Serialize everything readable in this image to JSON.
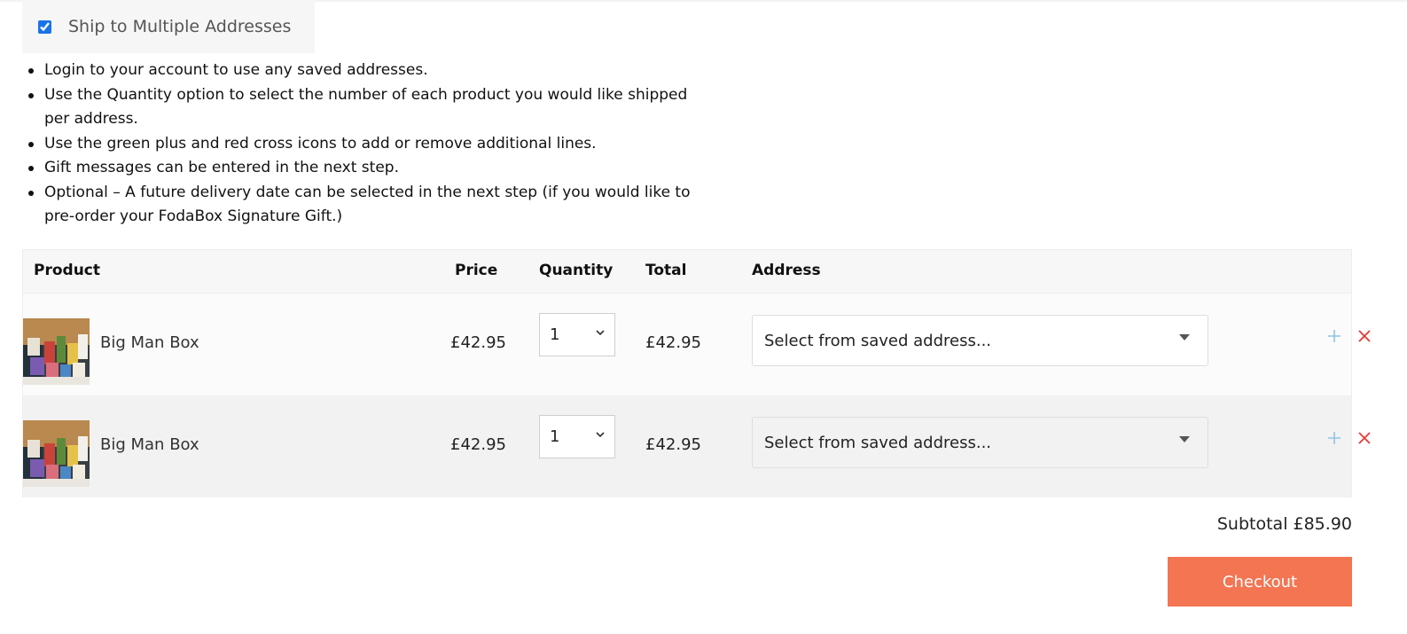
{
  "ship_toggle": {
    "label": "Ship to Multiple Addresses",
    "checked": true
  },
  "instructions": [
    "Login to your account to use any saved addresses.",
    "Use the Quantity option to select the number of each product you would like shipped per address.",
    "Use the green plus and red cross icons to add or remove additional lines.",
    "Gift messages can be entered in the next step.",
    "Optional – A future delivery date can be selected in the next step (if you would like to pre-order your FodaBox Signature Gift.)"
  ],
  "table": {
    "headers": {
      "product": "Product",
      "price": "Price",
      "quantity": "Quantity",
      "total": "Total",
      "address": "Address"
    },
    "rows": [
      {
        "product": "Big Man Box",
        "price": "£42.95",
        "quantity": "1",
        "total": "£42.95",
        "address_placeholder": "Select from saved address..."
      },
      {
        "product": "Big Man Box",
        "price": "£42.95",
        "quantity": "1",
        "total": "£42.95",
        "address_placeholder": "Select from saved address..."
      }
    ]
  },
  "subtotal": "Subtotal £85.90",
  "checkout_label": "Checkout",
  "colors": {
    "checkout": "#f37552",
    "plus_icon": "#8ec4e3",
    "cross_icon": "#e53935",
    "header_bg": "#f7f7f7",
    "alt_row_bg": "#f2f2f2"
  },
  "icons": {
    "plus": "plus-icon",
    "cross": "cross-icon",
    "dropdown": "chevron-down-icon"
  }
}
